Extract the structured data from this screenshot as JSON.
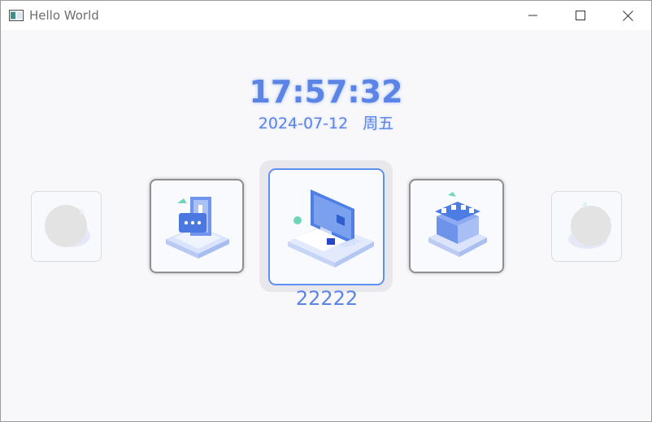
{
  "window": {
    "title": "Hello World",
    "controls": [
      "minimize",
      "maximize",
      "close"
    ]
  },
  "clock": {
    "time": "17:57:32",
    "date": "2024-07-12",
    "weekday": "周五"
  },
  "carousel": {
    "selected_label": "22222",
    "items": [
      {
        "icon": "circle-placeholder-icon",
        "state": "far-left"
      },
      {
        "icon": "security-login-icon",
        "state": "left"
      },
      {
        "icon": "computer-desk-icon",
        "state": "selected"
      },
      {
        "icon": "store-front-icon",
        "state": "right"
      },
      {
        "icon": "circle-placeholder-icon",
        "state": "far-right"
      }
    ]
  },
  "colors": {
    "accent": "#5b84e6",
    "selected_border": "#5f8ff0",
    "window_bg": "#f8f8fb"
  }
}
